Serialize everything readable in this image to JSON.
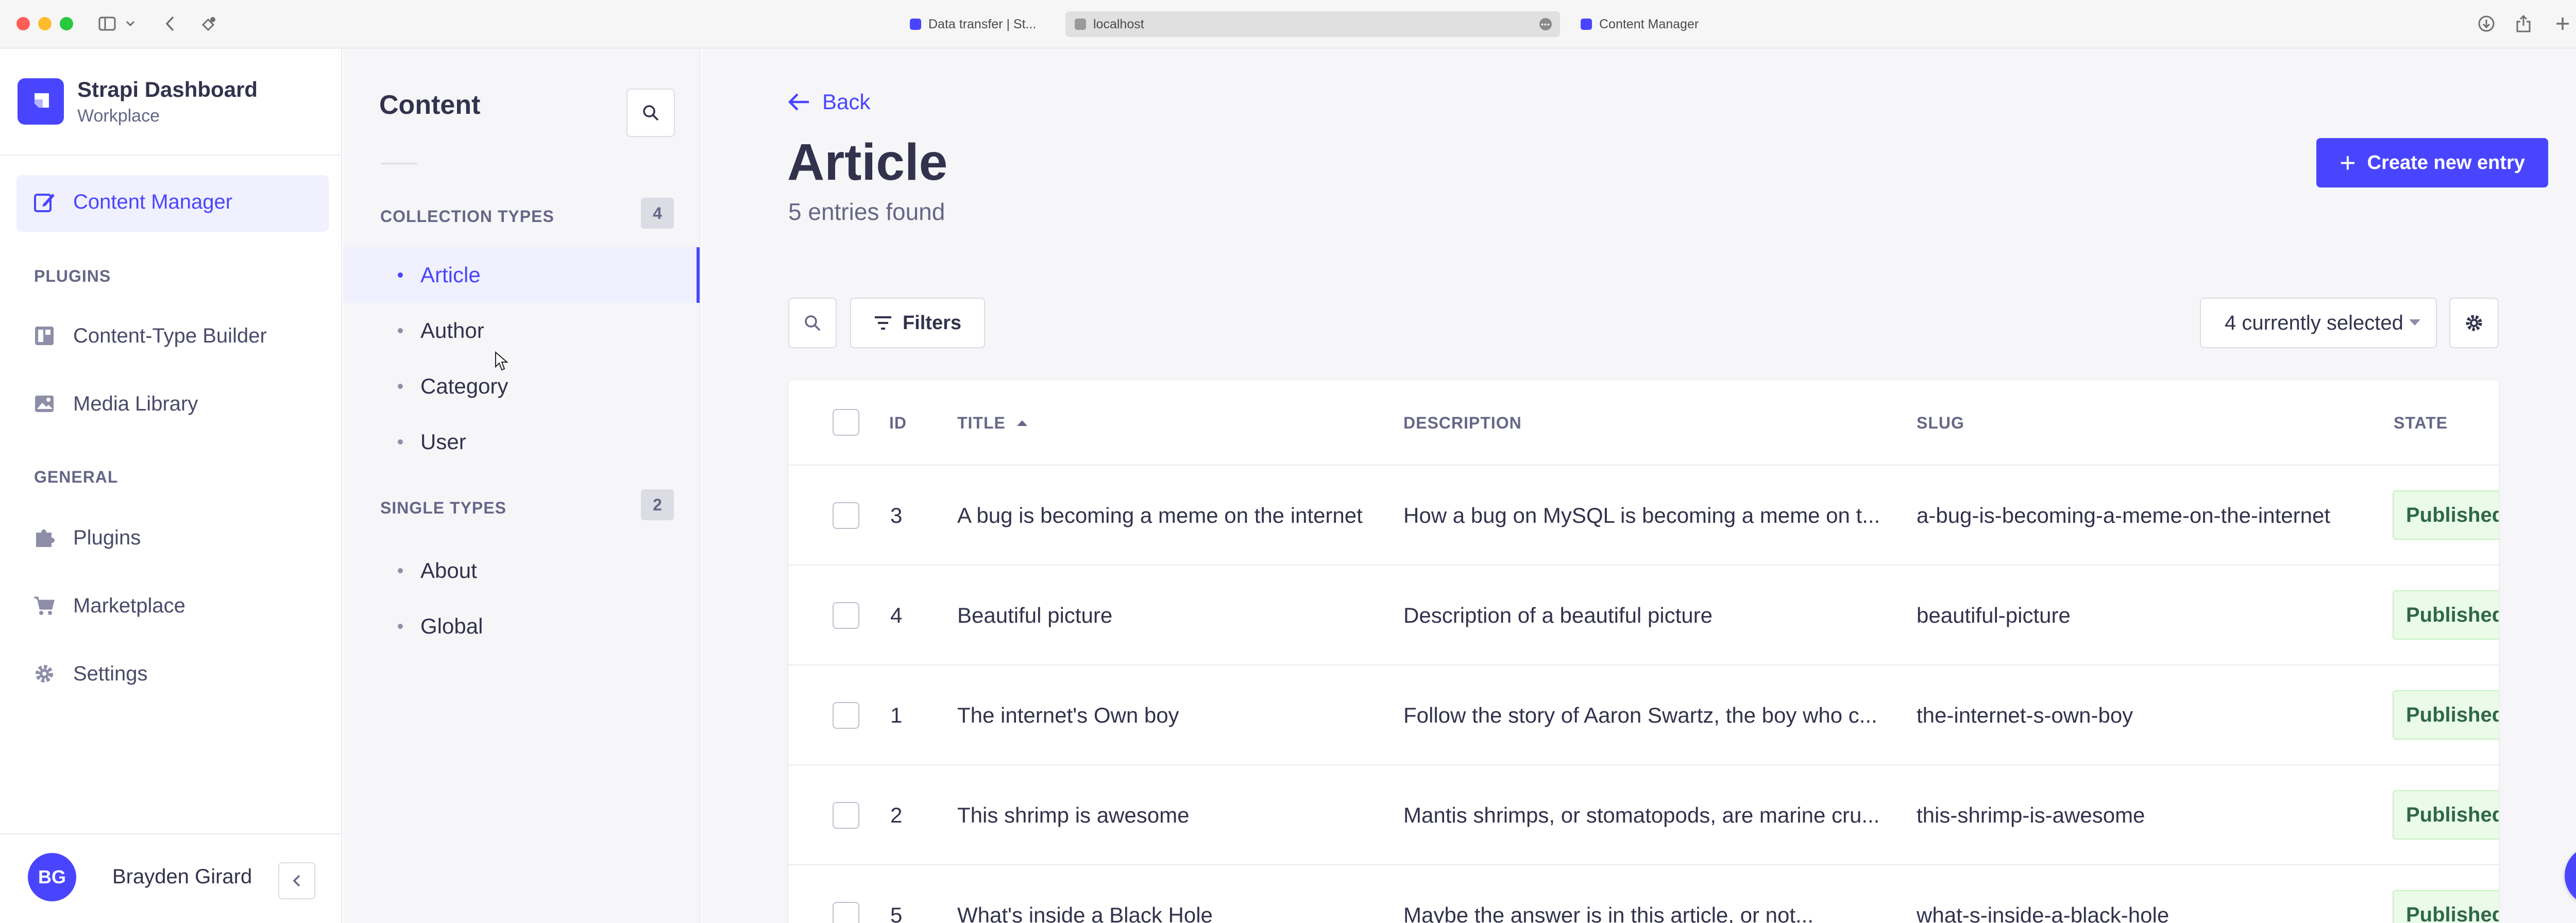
{
  "browser": {
    "tabs": [
      {
        "title": "Data transfer | St..."
      },
      {
        "title": "localhost"
      },
      {
        "title": "Content Manager"
      }
    ],
    "more_label": "•••"
  },
  "brand": {
    "title": "Strapi Dashboard",
    "subtitle": "Workplace"
  },
  "main_nav": {
    "content_manager": "Content Manager",
    "plugins_section": "PLUGINS",
    "plugins_items": [
      "Content-Type Builder",
      "Media Library"
    ],
    "general_section": "GENERAL",
    "general_items": [
      "Plugins",
      "Marketplace",
      "Settings"
    ]
  },
  "user": {
    "initials": "BG",
    "name": "Brayden Girard"
  },
  "content_nav": {
    "title": "Content",
    "collection_section": "COLLECTION TYPES",
    "collection_count": "4",
    "collection_items": [
      "Article",
      "Author",
      "Category",
      "User"
    ],
    "single_section": "SINGLE TYPES",
    "single_count": "2",
    "single_items": [
      "About",
      "Global"
    ]
  },
  "page": {
    "back_label": "Back",
    "title": "Article",
    "subtitle": "5 entries found",
    "create_label": "Create new entry",
    "filters_label": "Filters",
    "columns_selected": "4 currently selected"
  },
  "table": {
    "headers": {
      "id": "ID",
      "title": "TITLE",
      "description": "DESCRIPTION",
      "slug": "SLUG",
      "state": "STATE"
    },
    "rows": [
      {
        "id": "3",
        "title": "A bug is becoming a meme on the internet",
        "description": "How a bug on MySQL is becoming a meme on t...",
        "slug": "a-bug-is-becoming-a-meme-on-the-internet",
        "state": "Published"
      },
      {
        "id": "4",
        "title": "Beautiful picture",
        "description": "Description of a beautiful picture",
        "slug": "beautiful-picture",
        "state": "Published"
      },
      {
        "id": "1",
        "title": "The internet's Own boy",
        "description": "Follow the story of Aaron Swartz, the boy who c...",
        "slug": "the-internet-s-own-boy",
        "state": "Published"
      },
      {
        "id": "2",
        "title": "This shrimp is awesome",
        "description": "Mantis shrimps, or stomatopods, are marine cru...",
        "slug": "this-shrimp-is-awesome",
        "state": "Published"
      },
      {
        "id": "5",
        "title": "What's inside a Black Hole",
        "description": "Maybe the answer is in this article, or not...",
        "slug": "what-s-inside-a-black-hole",
        "state": "Published"
      }
    ]
  },
  "help_label": "?",
  "colors": {
    "accent": "#4945ff",
    "published_bg": "#eafbe7",
    "published_text": "#2f6846"
  }
}
